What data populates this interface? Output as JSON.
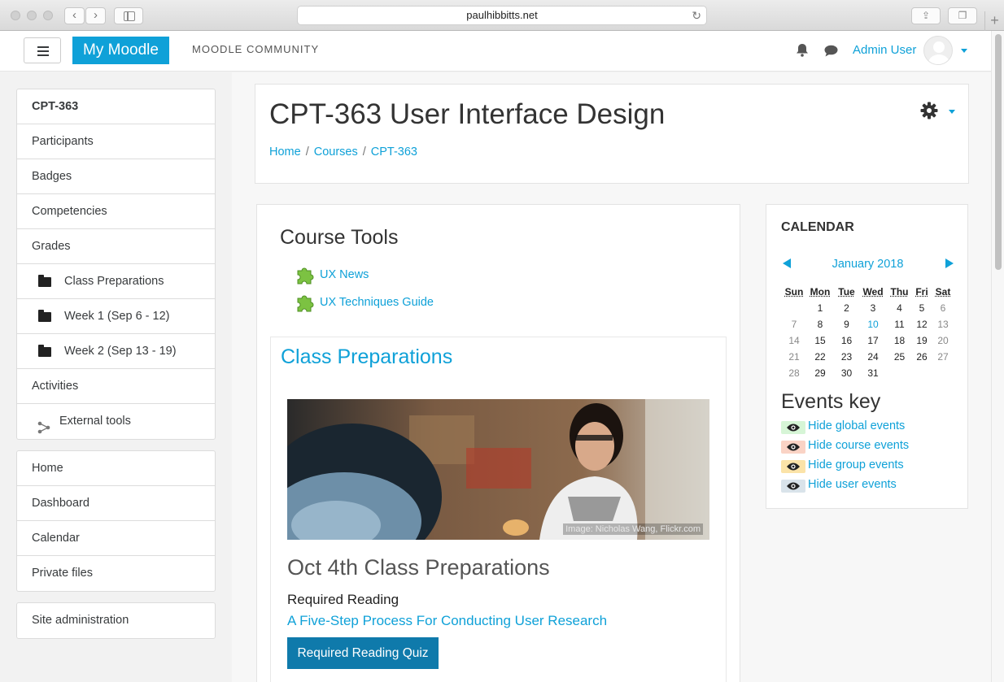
{
  "browser": {
    "url": "paulhibbitts.net"
  },
  "navbar": {
    "brand": "My Moodle",
    "community": "MOODLE COMMUNITY",
    "user_name": "Admin User"
  },
  "drawer": {
    "course_group": [
      {
        "label": "CPT-363",
        "style": "bold"
      },
      {
        "label": "Participants",
        "style": "plain"
      },
      {
        "label": "Badges",
        "style": "plain"
      },
      {
        "label": "Competencies",
        "style": "plain"
      },
      {
        "label": "Grades",
        "style": "plain"
      },
      {
        "label": "Class Preparations",
        "style": "folder"
      },
      {
        "label": "Week 1 (Sep 6 - 12)",
        "style": "folder"
      },
      {
        "label": "Week 2 (Sep 13 - 19)",
        "style": "folder"
      },
      {
        "label": "Activities",
        "style": "plain"
      },
      {
        "label": "External tools",
        "style": "tool"
      }
    ],
    "site_group": [
      {
        "label": "Home"
      },
      {
        "label": "Dashboard"
      },
      {
        "label": "Calendar"
      },
      {
        "label": "Private files"
      }
    ],
    "admin_group": [
      {
        "label": "Site administration"
      }
    ]
  },
  "header": {
    "title": "CPT-363 User Interface Design",
    "breadcrumb": [
      "Home",
      "Courses",
      "CPT-363"
    ]
  },
  "course_tools": {
    "heading": "Course Tools",
    "links": [
      "UX News",
      "UX Techniques Guide"
    ]
  },
  "class_prep": {
    "title": "Class Preparations",
    "image_credit": "Image: Nicholas Wang, Flickr.com",
    "subtitle": "Oct 4th Class Preparations",
    "required_label": "Required Reading",
    "reading_link": "A Five-Step Process For Conducting User Research",
    "quiz_button": "Required Reading Quiz"
  },
  "calendar": {
    "heading": "CALENDAR",
    "month": "January 2018",
    "weekdays": [
      "Sun",
      "Mon",
      "Tue",
      "Wed",
      "Thu",
      "Fri",
      "Sat"
    ],
    "weeks": [
      [
        "",
        "1",
        "2",
        "3",
        "4",
        "5",
        "6"
      ],
      [
        "7",
        "8",
        "9",
        "10",
        "11",
        "12",
        "13"
      ],
      [
        "14",
        "15",
        "16",
        "17",
        "18",
        "19",
        "20"
      ],
      [
        "21",
        "22",
        "23",
        "24",
        "25",
        "26",
        "27"
      ],
      [
        "28",
        "29",
        "30",
        "31",
        "",
        "",
        ""
      ]
    ],
    "today": "10"
  },
  "events_key": {
    "heading": "Events key",
    "items": [
      {
        "label": "Hide global events",
        "color": "#d6f5d6"
      },
      {
        "label": "Hide course events",
        "color": "#fad3c5"
      },
      {
        "label": "Hide group events",
        "color": "#fbe3a8"
      },
      {
        "label": "Hide user events",
        "color": "#d9e3ea"
      }
    ]
  },
  "colors": {
    "accent": "#0fa1d8",
    "button": "#0f7aab"
  }
}
